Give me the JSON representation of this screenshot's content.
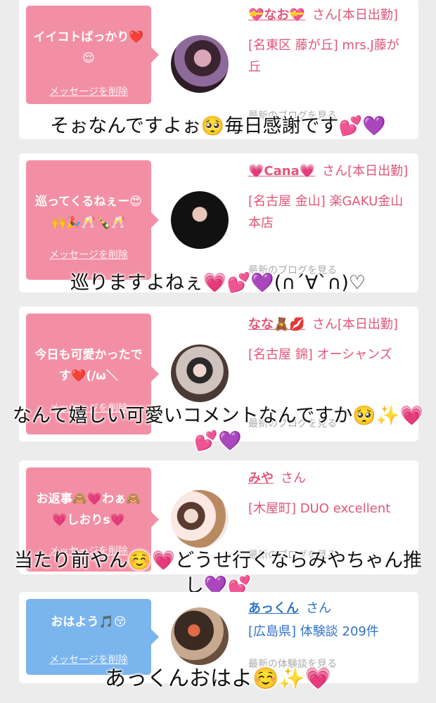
{
  "cards": [
    {
      "bubble": "イイコトばっかり❤️😌",
      "delete": "メッセージを削除",
      "name": "💝なお💝",
      "honorific": "さん[本日出勤]",
      "location": "[名東区 藤が丘] mrs.J藤が丘",
      "latest": "最新のブログを見る",
      "reply": "そぉなんですよぉ🥺毎日感謝です💕💜"
    },
    {
      "bubble": "巡ってくるねぇー😍🙌🎉🥂🍾🥂",
      "delete": "メッセージを削除",
      "name": "💗Cana💗",
      "honorific": "さん[本日出勤]",
      "location": "[名古屋 金山] 楽GAKU金山本店",
      "latest": "最新のブログを見る",
      "reply": "巡りますよねぇ💗💕💜(∩´∀`∩)♡"
    },
    {
      "bubble": "今日も可愛かったです❤️(/ω＼",
      "delete": "メッセージを削除",
      "name": "なな🧸💋",
      "honorific": "さん[本日出勤]",
      "location": "[名古屋 錦] オーシャンズ",
      "latest": "最新のブログを見る",
      "reply": "なんて嬉しい可愛いコメントなんですか🥺✨💗💕💜"
    },
    {
      "bubble": "お返事🙈💗わぁ🙈💗しおりs💗",
      "delete": "メッセージを削除",
      "name": "みや",
      "honorific": "さん",
      "location": "[木屋町] DUO excellent",
      "latest": "最新のブログを見る",
      "reply": "当たり前やん☺️💗どうせ行くならみやちゃん推し💜💕"
    },
    {
      "bubble": "おはよう🎵😚",
      "delete": "メッセージを削除",
      "name": "あっくん",
      "honorific": "さん",
      "location": "[広島県] 体験談 209件",
      "latest": "最新の体験談を見る",
      "reply": "あっくんおはよ☺️✨💗"
    }
  ],
  "colors": {
    "pink": "#f38fa4",
    "blue": "#7bb5ee",
    "name_pink": "#e0577a",
    "name_blue": "#2f72c8"
  }
}
